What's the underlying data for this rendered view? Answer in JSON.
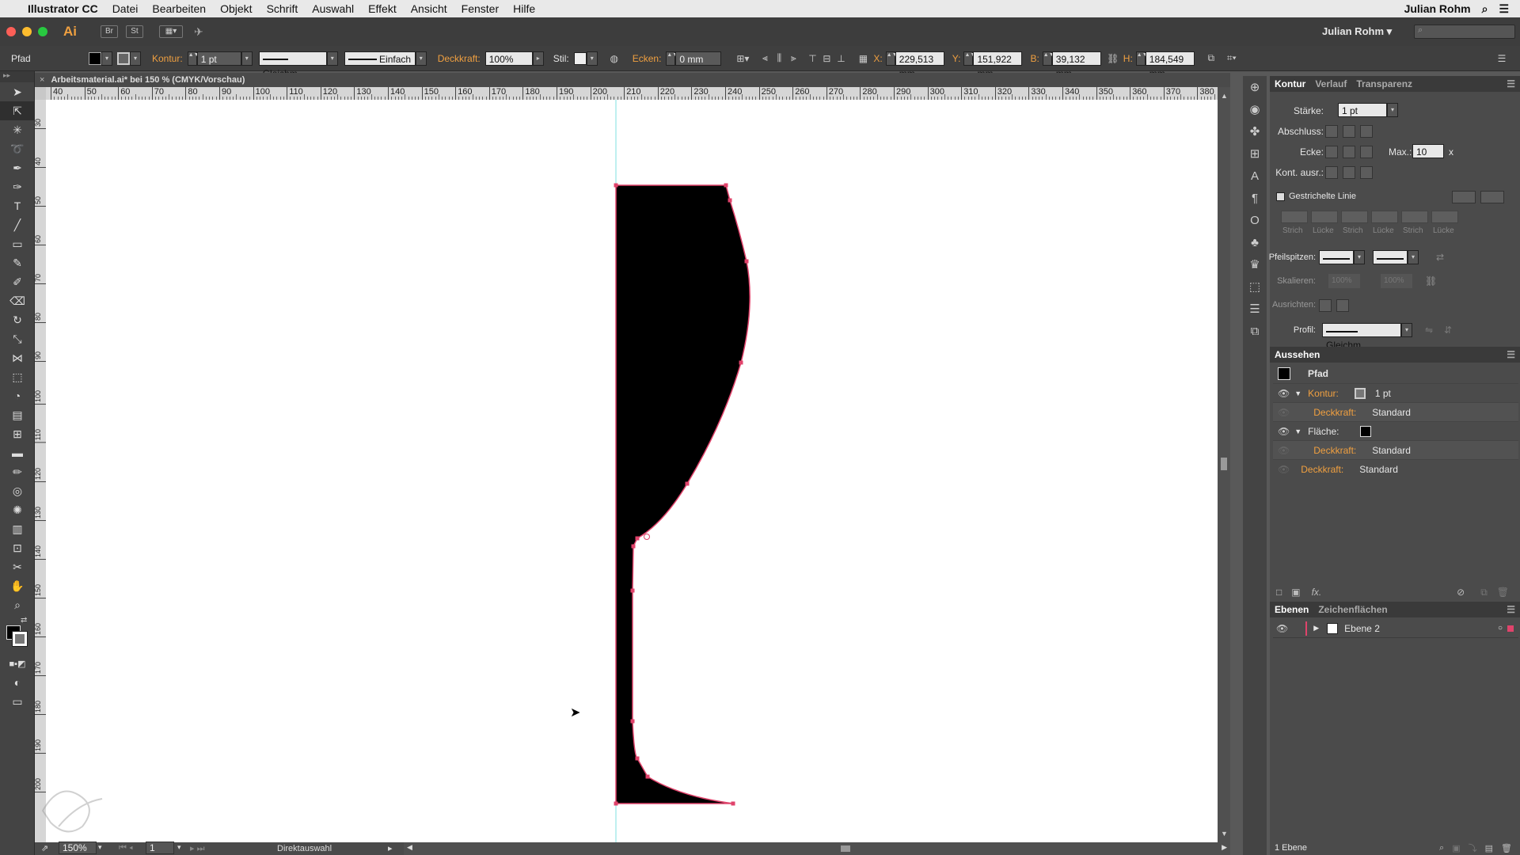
{
  "mac_menu": {
    "app_name": "Illustrator CC",
    "items": [
      "Datei",
      "Bearbeiten",
      "Objekt",
      "Schrift",
      "Auswahl",
      "Effekt",
      "Ansicht",
      "Fenster",
      "Hilfe"
    ],
    "user": "Julian Rohm"
  },
  "app_bar": {
    "logo": "Ai",
    "bridge": "Br",
    "stock": "St",
    "workspace_user": "Julian Rohm"
  },
  "control_bar": {
    "selection_type": "Pfad",
    "kontur_label": "Kontur:",
    "kontur_value": "1 pt",
    "profile_value": "Gleichm.",
    "brush_value": "Einfach",
    "opacity_label": "Deckkraft:",
    "opacity_value": "100%",
    "style_label": "Stil:",
    "corners_label": "Ecken:",
    "corners_value": "0 mm",
    "x_label": "X:",
    "x_value": "229,513 mm",
    "y_label": "Y:",
    "y_value": "151,922 mm",
    "w_label": "B:",
    "w_value": "39,132 mm",
    "h_label": "H:",
    "h_value": "184,549 mm"
  },
  "document_tab": {
    "title": "Arbeitsmaterial.ai* bei 150 % (CMYK/Vorschau)"
  },
  "ruler": {
    "h_ticks": [
      "40",
      "50",
      "60",
      "70",
      "80",
      "90",
      "100",
      "110",
      "120",
      "130",
      "140",
      "150",
      "160",
      "170",
      "180",
      "190",
      "200",
      "210",
      "220",
      "230",
      "240",
      "250",
      "260",
      "270",
      "280",
      "290",
      "300",
      "310",
      "320",
      "330",
      "340",
      "350",
      "360",
      "370",
      "380"
    ],
    "v_ticks": [
      "3",
      "4",
      "5",
      "6",
      "7",
      "8",
      "9",
      "10",
      "11",
      "12",
      "13",
      "14",
      "15",
      "16",
      "17",
      "18",
      "19",
      "20"
    ]
  },
  "status_bar": {
    "zoom": "150%",
    "artboard": "1",
    "tool": "Direktauswahl"
  },
  "kontur_panel": {
    "tabs": [
      "Kontur",
      "Verlauf",
      "Transparenz"
    ],
    "staerke_label": "Stärke:",
    "staerke_value": "1 pt",
    "abschluss_label": "Abschluss:",
    "ecke_label": "Ecke:",
    "max_label": "Max.:",
    "max_value": "10",
    "max_unit": "x",
    "kont_label": "Kont. ausr.:",
    "dashed_label": "Gestrichelte Linie",
    "dash_labels": [
      "Strich",
      "Lücke",
      "Strich",
      "Lücke",
      "Strich",
      "Lücke"
    ],
    "arrows_label": "Pfeilspitzen:",
    "scale_label": "Skalieren:",
    "scale_value_1": "100%",
    "scale_value_2": "100%",
    "align_label": "Ausrichten:",
    "profile_label": "Profil:",
    "profile_value": "Gleichm."
  },
  "aussehen_panel": {
    "title": "Aussehen",
    "object": "Pfad",
    "kontur_label": "Kontur:",
    "kontur_value": "1 pt",
    "opacity_label": "Deckkraft:",
    "opacity_value": "Standard",
    "flaeche_label": "Fläche:",
    "opacity2_label": "Deckkraft:",
    "opacity2_value": "Standard",
    "opacity3_label": "Deckkraft:",
    "opacity3_value": "Standard",
    "fx": "fx."
  },
  "layers_panel": {
    "tabs": [
      "Ebenen",
      "Zeichenflächen"
    ],
    "layer_name": "Ebene 2",
    "footer": "1 Ebene"
  },
  "colors": {
    "fill": "#000000",
    "path_stroke": "#e0436b",
    "guide": "#7fe0e0",
    "accent_orange": "#f0a040"
  }
}
